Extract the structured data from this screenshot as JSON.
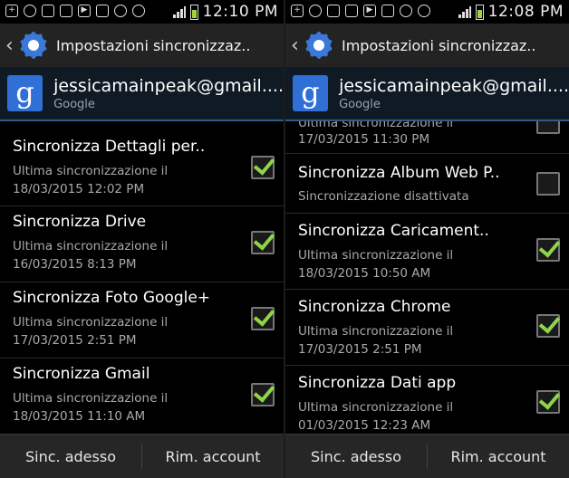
{
  "app": {
    "title": "Impostazioni sincronizzaz..",
    "account_email": "jessicamainpeak@gmail....",
    "account_type": "Google"
  },
  "buttons": {
    "sync_now": "Sinc. adesso",
    "remove_account": "Rim. account"
  },
  "left": {
    "time": "12:10 PM",
    "items": [
      {
        "title": "Sincronizza Dettagli per..",
        "line1": "Ultima sincronizzazione il",
        "line2": "18/03/2015 12:02 PM",
        "checked": true
      },
      {
        "title": "Sincronizza Drive",
        "line1": "Ultima sincronizzazione il",
        "line2": "16/03/2015 8:13 PM",
        "checked": true
      },
      {
        "title": "Sincronizza Foto Google+",
        "line1": "Ultima sincronizzazione il",
        "line2": "17/03/2015 2:51 PM",
        "checked": true
      },
      {
        "title": "Sincronizza Gmail",
        "line1": "Ultima sincronizzazione il",
        "line2": "18/03/2015 11:10 AM",
        "checked": true
      }
    ]
  },
  "right": {
    "time": "12:08 PM",
    "partial_item": {
      "line1": "Ultima sincronizzazione il",
      "line2": "17/03/2015 11:30 PM",
      "checked": false
    },
    "items": [
      {
        "title": "Sincronizza Album Web P..",
        "line1": "Sincronizzazione disattivata",
        "line2": "",
        "checked": false
      },
      {
        "title": "Sincronizza Caricament..",
        "line1": "Ultima sincronizzazione il",
        "line2": "18/03/2015 10:50 AM",
        "checked": true
      },
      {
        "title": "Sincronizza Chrome",
        "line1": "Ultima sincronizzazione il",
        "line2": "17/03/2015 2:51 PM",
        "checked": true
      },
      {
        "title": "Sincronizza Dati app",
        "line1": "Ultima sincronizzazione il",
        "line2": "01/03/2015 12:23 AM",
        "checked": true
      }
    ]
  },
  "colors": {
    "check": "#8fd44a",
    "header_accent": "#2c5d8a",
    "gear": "#3b78d8"
  }
}
